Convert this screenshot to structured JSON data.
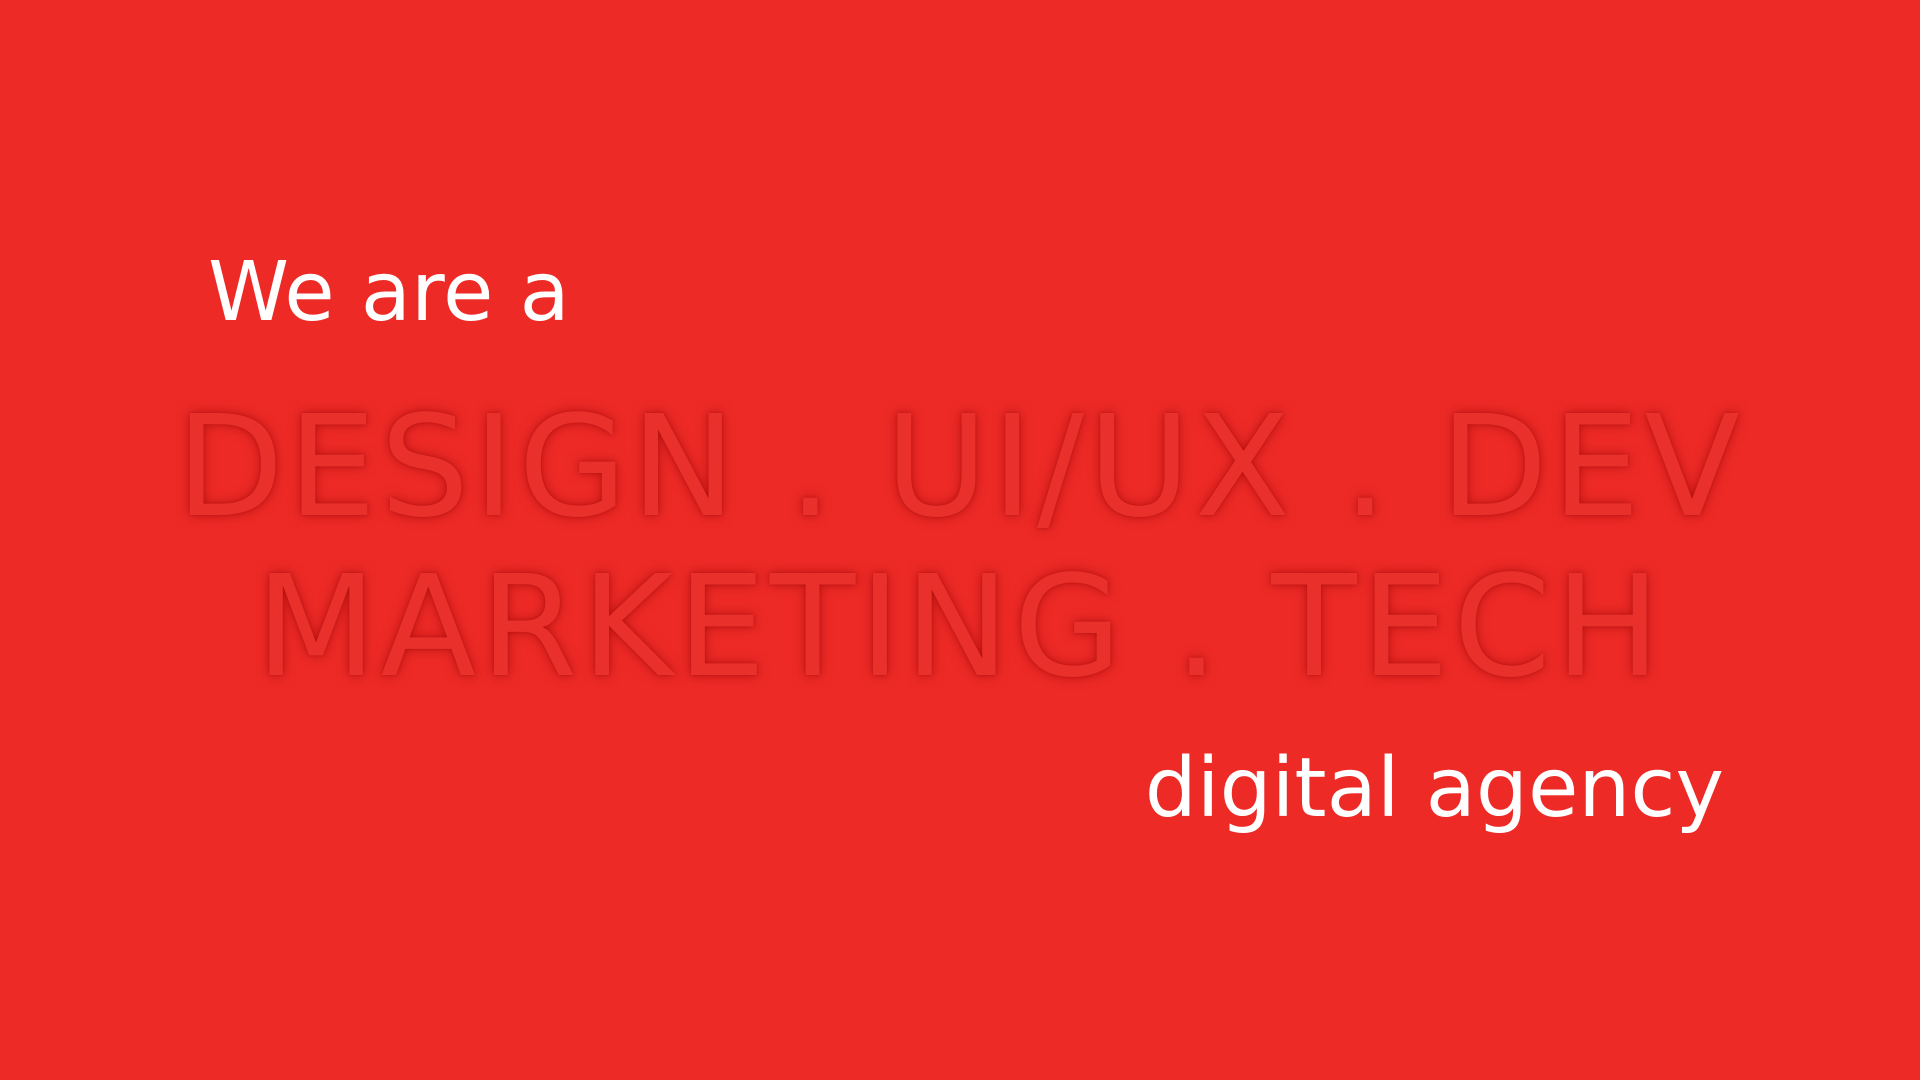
{
  "slide": {
    "background_color": "#ed2a26",
    "intro": "We are a",
    "services": [
      "DESIGN . UI/UX . DEV",
      "MARKETING . TECH"
    ],
    "outro": "digital agency",
    "text_color": "#ffffff",
    "services_color": "#e9302b"
  }
}
